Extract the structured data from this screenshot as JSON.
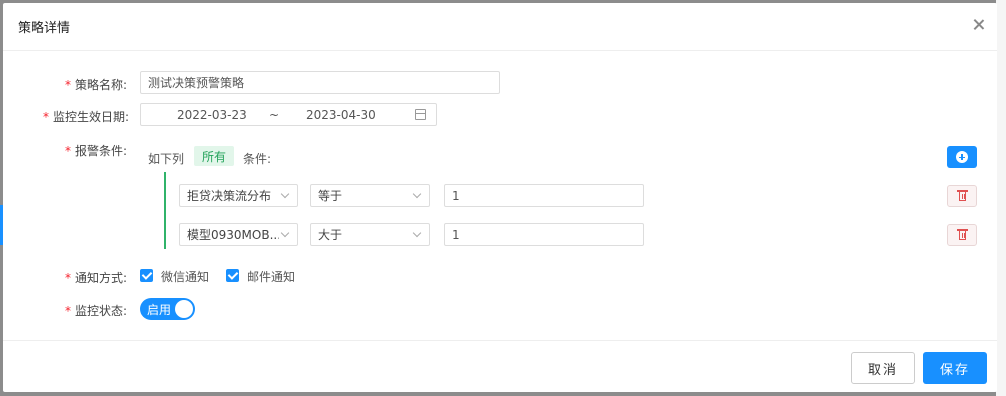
{
  "modal": {
    "title": "策略详情"
  },
  "form": {
    "name": {
      "label": "策略名称:",
      "value": "测试决策预警策略"
    },
    "date": {
      "label": "监控生效日期:",
      "start": "2022-03-23",
      "separator": "~",
      "end": "2023-04-30"
    },
    "alarm": {
      "label": "报警条件:",
      "prefix": "如下列",
      "match": "所有",
      "suffix": "条件:",
      "conditions": [
        {
          "field": "拒贷决策流分布",
          "operator": "等于",
          "value": "1"
        },
        {
          "field": "模型0930MOB...",
          "operator": "大于",
          "value": "1"
        }
      ]
    },
    "notify": {
      "label": "通知方式:",
      "options": [
        "微信通知",
        "邮件通知"
      ]
    },
    "status": {
      "label": "监控状态:",
      "toggle_text": "启用",
      "enabled": true
    }
  },
  "footer": {
    "cancel_label": "取消",
    "save_label": "保存"
  },
  "colors": {
    "primary": "#1890ff",
    "required": "#f5222d",
    "match_tag": "#23a35a"
  }
}
